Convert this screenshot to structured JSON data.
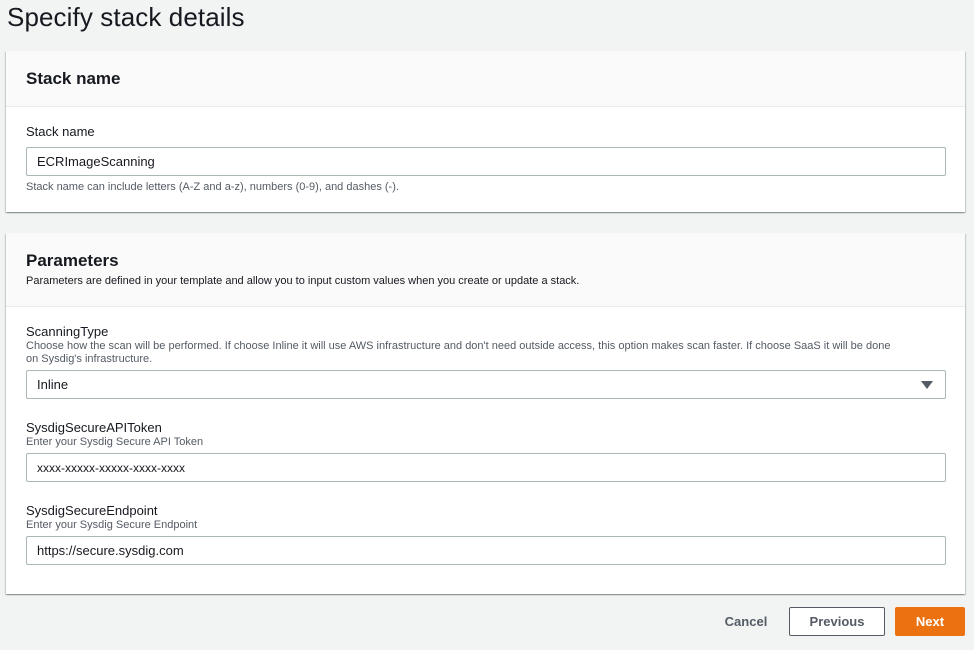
{
  "page": {
    "title": "Specify stack details"
  },
  "stack_name_section": {
    "heading": "Stack name",
    "field_label": "Stack name",
    "value": "ECRImageScanning",
    "hint": "Stack name can include letters (A-Z and a-z), numbers (0-9), and dashes (-)."
  },
  "parameters_section": {
    "heading": "Parameters",
    "description": "Parameters are defined in your template and allow you to input custom values when you create or update a stack.",
    "scanning_type": {
      "label": "ScanningType",
      "description_line1": "Choose how the scan will be performed. If choose Inline it will use AWS infrastructure and don't need outside access, this option makes scan faster. If choose SaaS it will be done",
      "description_line2": "on Sysdig's infrastructure.",
      "selected": "Inline"
    },
    "api_token": {
      "label": "SysdigSecureAPIToken",
      "description": "Enter your Sysdig Secure API Token",
      "value": "xxxx-xxxxx-xxxxx-xxxx-xxxx"
    },
    "endpoint": {
      "label": "SysdigSecureEndpoint",
      "description": "Enter your Sysdig Secure Endpoint",
      "value": "https://secure.sysdig.com"
    }
  },
  "footer": {
    "cancel_label": "Cancel",
    "previous_label": "Previous",
    "next_label": "Next"
  },
  "colors": {
    "primary": "#ec7211",
    "background": "#f2f3f3",
    "border": "#aab7b8"
  },
  "icons": {
    "select_caret": "caret-down-icon"
  }
}
